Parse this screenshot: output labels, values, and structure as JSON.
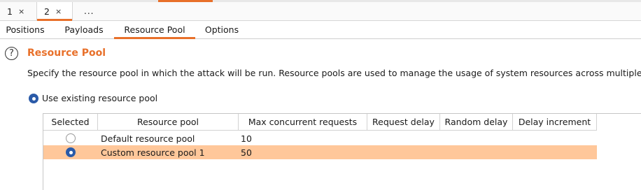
{
  "instance_tabs": [
    {
      "label": "1",
      "close": "×"
    },
    {
      "label": "2",
      "close": "×"
    },
    {
      "label": "..."
    }
  ],
  "sub_tabs": [
    "Positions",
    "Payloads",
    "Resource Pool",
    "Options"
  ],
  "section": {
    "help_glyph": "?",
    "title": "Resource Pool",
    "description": "Specify the resource pool in which the attack will be run. Resource pools are used to manage the usage of system resources across multiple tasks."
  },
  "option_existing": "Use existing resource pool",
  "table": {
    "columns": [
      "Selected",
      "Resource pool",
      "Max concurrent requests",
      "Request delay",
      "Random delay",
      "Delay increment"
    ],
    "rows": [
      {
        "name": "Default resource pool",
        "max_concurrent": "10",
        "request_delay": "",
        "random_delay": "",
        "delay_increment": "",
        "selected": false
      },
      {
        "name": "Custom resource pool 1",
        "max_concurrent": "50",
        "request_delay": "",
        "random_delay": "",
        "delay_increment": "",
        "selected": true
      }
    ]
  },
  "colors": {
    "accent": "#e8702a",
    "selection": "#ffc79a",
    "radio": "#2a5aa8"
  }
}
